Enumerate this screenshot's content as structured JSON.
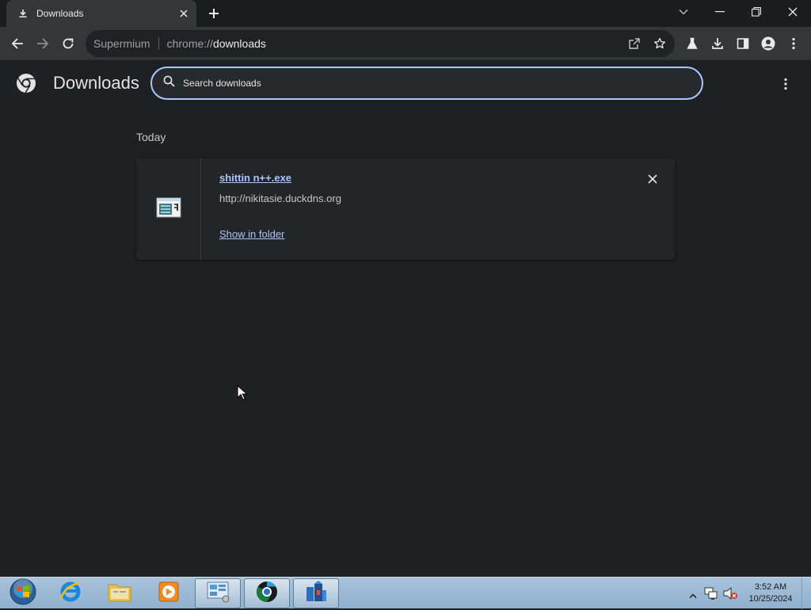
{
  "tab": {
    "title": "Downloads"
  },
  "omnibox": {
    "site_name": "Supermium",
    "url_scheme": "chrome://",
    "url_path": "downloads"
  },
  "page": {
    "title": "Downloads",
    "search_placeholder": "Search downloads"
  },
  "downloads": {
    "date_header": "Today",
    "items": [
      {
        "file_name": "shittin n++.exe",
        "url": "http://nikitasie.duckdns.org",
        "action_label": "Show in folder"
      }
    ]
  },
  "taskbar": {
    "apps": [
      "start-orb",
      "internet-explorer",
      "file-explorer",
      "media-player",
      "control-panel",
      "supermium",
      "app"
    ],
    "clock_time": "3:52 AM",
    "clock_date": "10/25/2024"
  },
  "colors": {
    "background": "#1f2023",
    "accent": "#a8c7fa",
    "toolbar": "#35363a",
    "taskbar": "#a9c3da"
  }
}
